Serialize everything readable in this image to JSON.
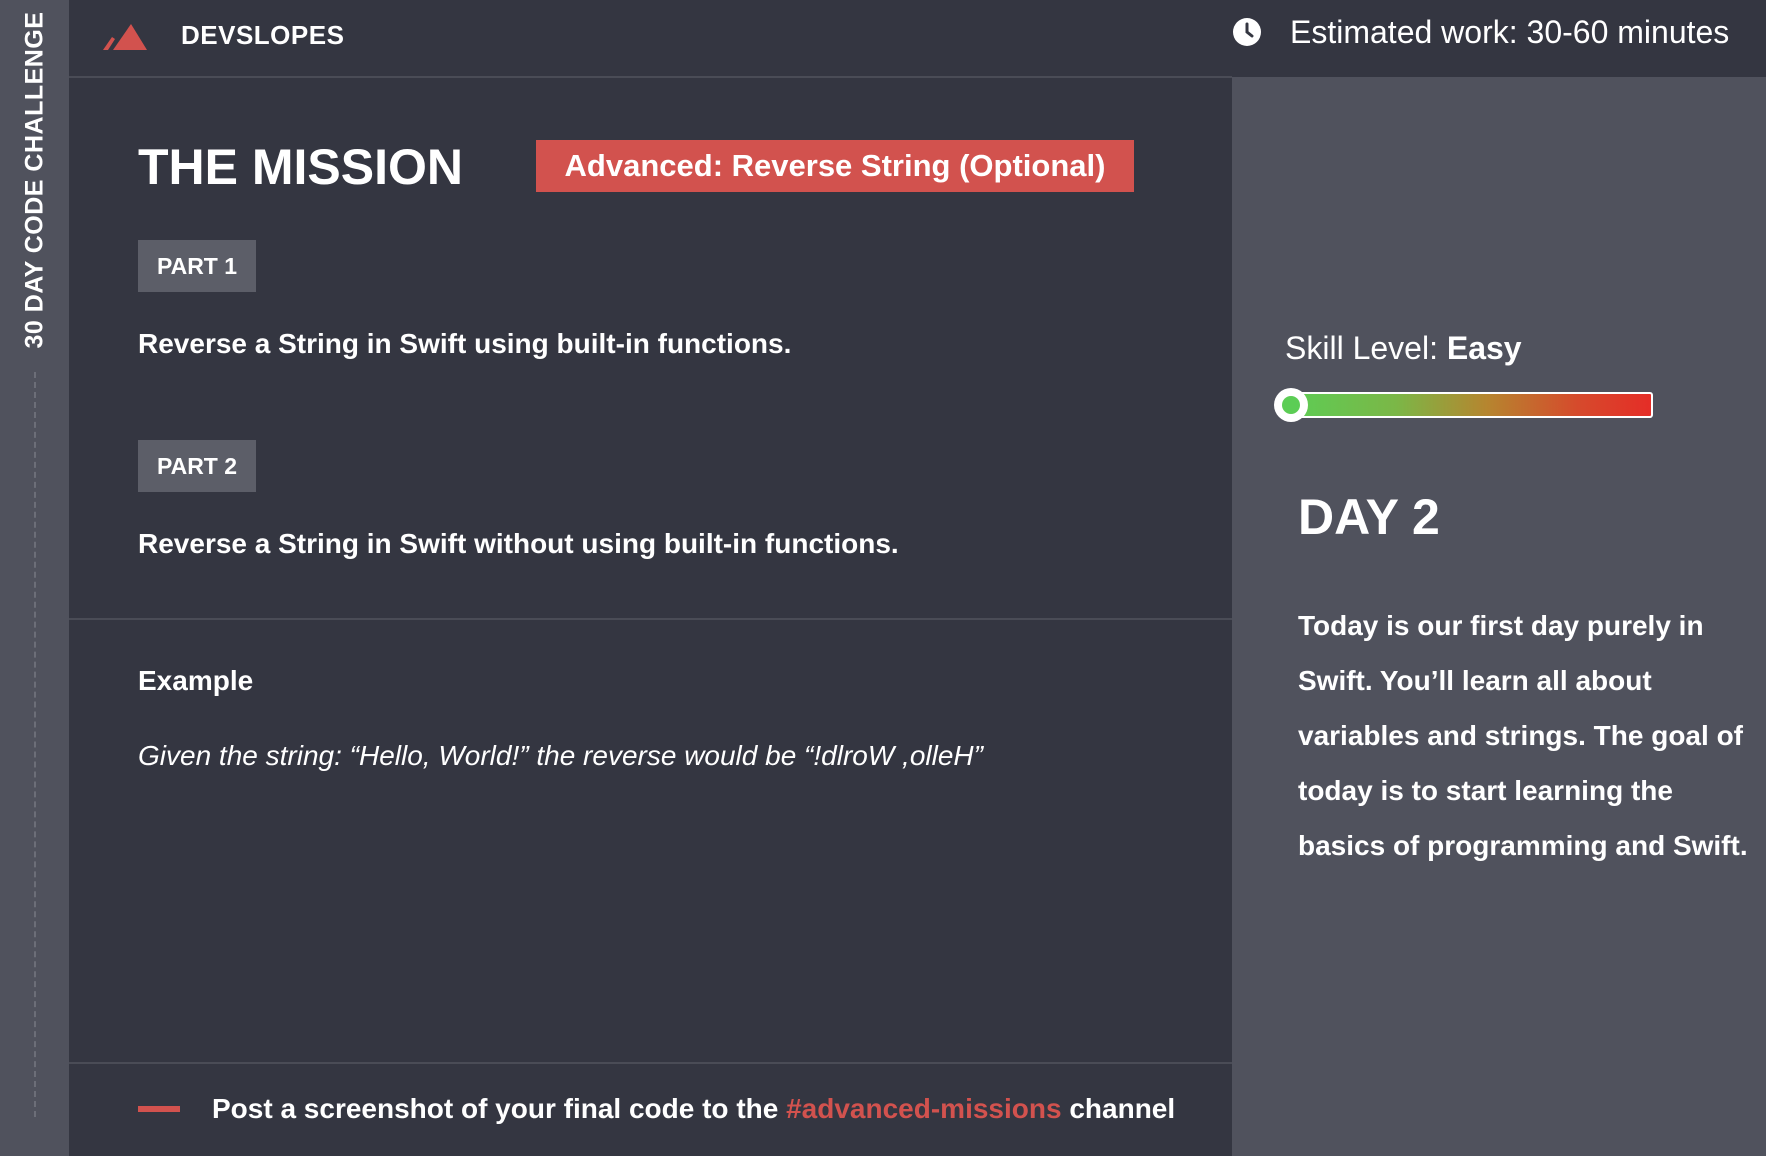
{
  "side_rail": {
    "title": "30 DAY CODE CHALLENGE"
  },
  "header": {
    "brand": "DEVSLOPES",
    "logo_icon": "mountain-logo-icon",
    "accent_color": "#d2524e"
  },
  "estimate": {
    "icon": "clock-icon",
    "text": "Estimated work: 30-60 minutes"
  },
  "mission": {
    "title": "THE MISSION",
    "badge": "Advanced: Reverse String (Optional)",
    "parts": [
      {
        "label": "PART 1",
        "description": "Reverse a String in Swift using built-in functions."
      },
      {
        "label": "PART 2",
        "description": "Reverse a String in Swift without using built-in functions."
      }
    ]
  },
  "example": {
    "heading": "Example",
    "text": "Given the string: “Hello, World!” the reverse would be “!dlroW ,olleH”"
  },
  "footer": {
    "prefix": "Post a screenshot of your final code to the ",
    "channel": "#advanced-missions",
    "suffix": " channel"
  },
  "skill": {
    "label_prefix": "Skill Level: ",
    "level": "Easy",
    "slider_value": 0,
    "gradient_colors": [
      "#5ccd55",
      "#b6852f",
      "#e52d27"
    ]
  },
  "day": {
    "title": "DAY 2",
    "description": "Today is our first day purely in Swift. You’ll learn all about variables and strings. The goal of today is to start learning the basics of programming and Swift."
  }
}
